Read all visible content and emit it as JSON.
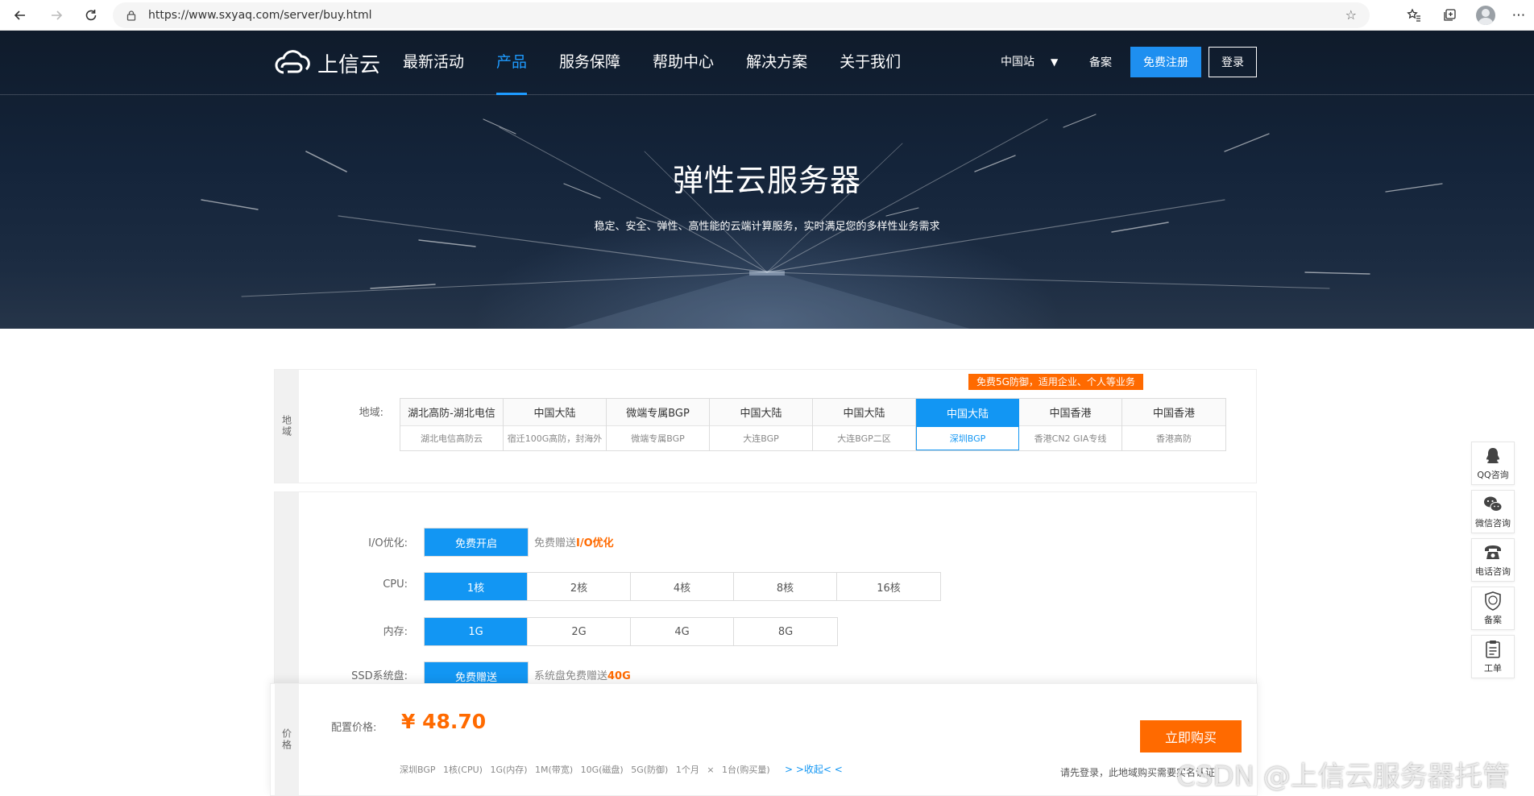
{
  "browser": {
    "url": "https://www.sxyaq.com/server/buy.html"
  },
  "nav": {
    "logo_text": "上信云",
    "menu": [
      "最新活动",
      "产品",
      "服务保障",
      "帮助中心",
      "解决方案",
      "关于我们"
    ],
    "active_menu": "产品",
    "site": "中国站",
    "beian": "备案",
    "register": "免费注册",
    "login": "登录"
  },
  "hero": {
    "title": "弹性云服务器",
    "subtitle": "稳定、安全、弹性、高性能的云端计算服务，实时满足您的多样性业务需求"
  },
  "region": {
    "tab": "地域",
    "label": "地域:",
    "promo": "免费5G防御，适用企业、个人等业务",
    "items": [
      {
        "name": "湖北高防-湖北电信",
        "sub": "湖北电信高防云"
      },
      {
        "name": "中国大陆",
        "sub": "宿迁100G高防，封海外"
      },
      {
        "name": "微端专属BGP",
        "sub": "微端专属BGP"
      },
      {
        "name": "中国大陆",
        "sub": "大连BGP"
      },
      {
        "name": "中国大陆",
        "sub": "大连BGP二区"
      },
      {
        "name": "中国大陆",
        "sub": "深圳BGP"
      },
      {
        "name": "中国香港",
        "sub": "香港CN2 GIA专线"
      },
      {
        "name": "中国香港",
        "sub": "香港高防"
      }
    ],
    "selected_index": 5
  },
  "config": {
    "io": {
      "label": "I/O优化:",
      "button": "免费开启",
      "note_prefix": "免费赠送",
      "note_highlight": "I/O优化"
    },
    "cpu": {
      "label": "CPU:",
      "options": [
        "1核",
        "2核",
        "4核",
        "8核",
        "16核"
      ],
      "selected_index": 0
    },
    "memory": {
      "label": "内存:",
      "options": [
        "1G",
        "2G",
        "4G",
        "8G"
      ],
      "selected_index": 0
    },
    "ssd": {
      "label": "SSD系统盘:",
      "button": "免费赠送",
      "note_prefix": "系统盘免费赠送",
      "note_highlight": "40G"
    }
  },
  "price": {
    "tab": "价格",
    "label": "配置价格:",
    "value": "¥ 48.70",
    "summary": "深圳BGP 1核(CPU) 1G(内存) 1M(带宽) 10G(磁盘) 5G(防御) 1个月 × 1台(购买量)",
    "collapse": "> >收起< <",
    "buy": "立即购买",
    "login_note": "请先登录，此地域购买需要实名认证"
  },
  "float_bar": [
    {
      "label": "QQ咨询",
      "icon": "qq-icon"
    },
    {
      "label": "微信咨询",
      "icon": "wechat-icon"
    },
    {
      "label": "电话咨询",
      "icon": "phone-icon"
    },
    {
      "label": "备案",
      "icon": "icp-shield-icon"
    },
    {
      "label": "工单",
      "icon": "clipboard-icon"
    }
  ],
  "watermark": "CSDN @上信云服务器托管",
  "colors": {
    "accent_blue": "#1296f3",
    "orange": "#ff6a00",
    "hero_dark": "#0f1b2b"
  }
}
